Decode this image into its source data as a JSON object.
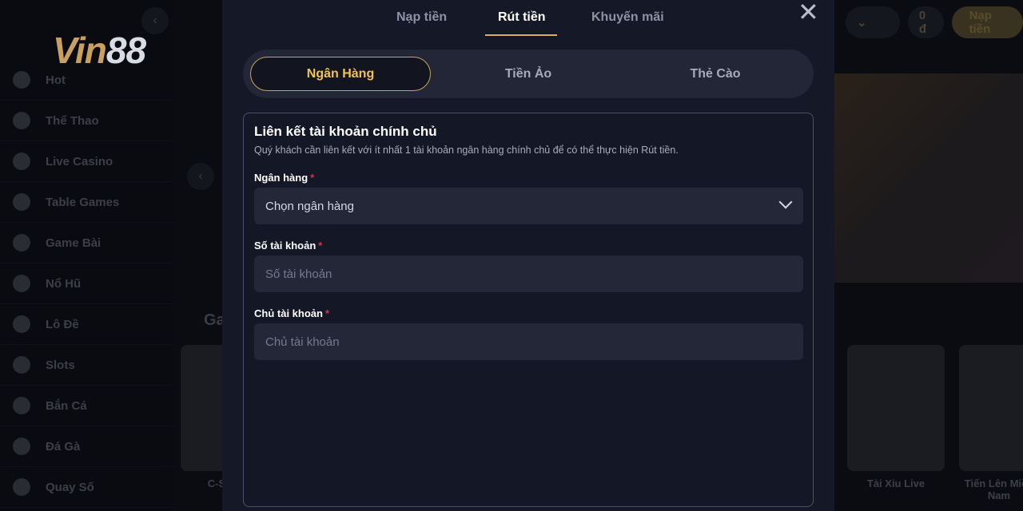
{
  "brand": {
    "logo_v": "Vin",
    "logo_n": "88"
  },
  "sidebar": {
    "items": [
      {
        "label": "Hot",
        "icon": "fire-icon"
      },
      {
        "label": "Thể Thao",
        "icon": "soccer-ball-icon"
      },
      {
        "label": "Live Casino",
        "icon": "spade-icon"
      },
      {
        "label": "Table Games",
        "icon": "crossed-swords-icon"
      },
      {
        "label": "Game Bài",
        "icon": "cards-icon"
      },
      {
        "label": "Nổ Hũ",
        "icon": "slot-machine-icon"
      },
      {
        "label": "Lô Đề",
        "icon": "lottery-ball-icon"
      },
      {
        "label": "Slots",
        "icon": "cherry-icon"
      },
      {
        "label": "Bắn Cá",
        "icon": "fish-icon"
      },
      {
        "label": "Đá Gà",
        "icon": "rooster-icon"
      },
      {
        "label": "Quay Số",
        "icon": "lottery-icon"
      }
    ]
  },
  "header": {
    "balance": "0 đ",
    "deposit": "Nạp tiền"
  },
  "background": {
    "section_title": "Ga",
    "games": [
      "C-S",
      "Tài Xỉu Live",
      "Tiến Lên Miền Nam"
    ]
  },
  "modal": {
    "tabs": [
      {
        "label": "Nạp tiền"
      },
      {
        "label": "Rút tiền",
        "active": true
      },
      {
        "label": "Khuyến mãi"
      }
    ],
    "methods": [
      {
        "label": "Ngân Hàng",
        "active": true
      },
      {
        "label": "Tiền Ảo"
      },
      {
        "label": "Thẻ Cào"
      }
    ],
    "form": {
      "title": "Liên kết tài khoản chính chủ",
      "description": "Quý khách cần liên kết với ít nhất 1 tài khoản ngân hàng chính chủ để có thể thực hiện Rút tiền.",
      "bank_label": "Ngân hàng",
      "bank_value": "Chọn ngân hàng",
      "account_label": "Số tài khoản",
      "account_placeholder": "Số tài khoản",
      "holder_label": "Chủ tài khoản",
      "holder_placeholder": "Chủ tài khoản",
      "required_mark": "*"
    }
  },
  "colors": {
    "accent": "#d7b15f",
    "active_text": "#f2c253",
    "required": "#d0344a",
    "modal_bg": "#151826"
  }
}
